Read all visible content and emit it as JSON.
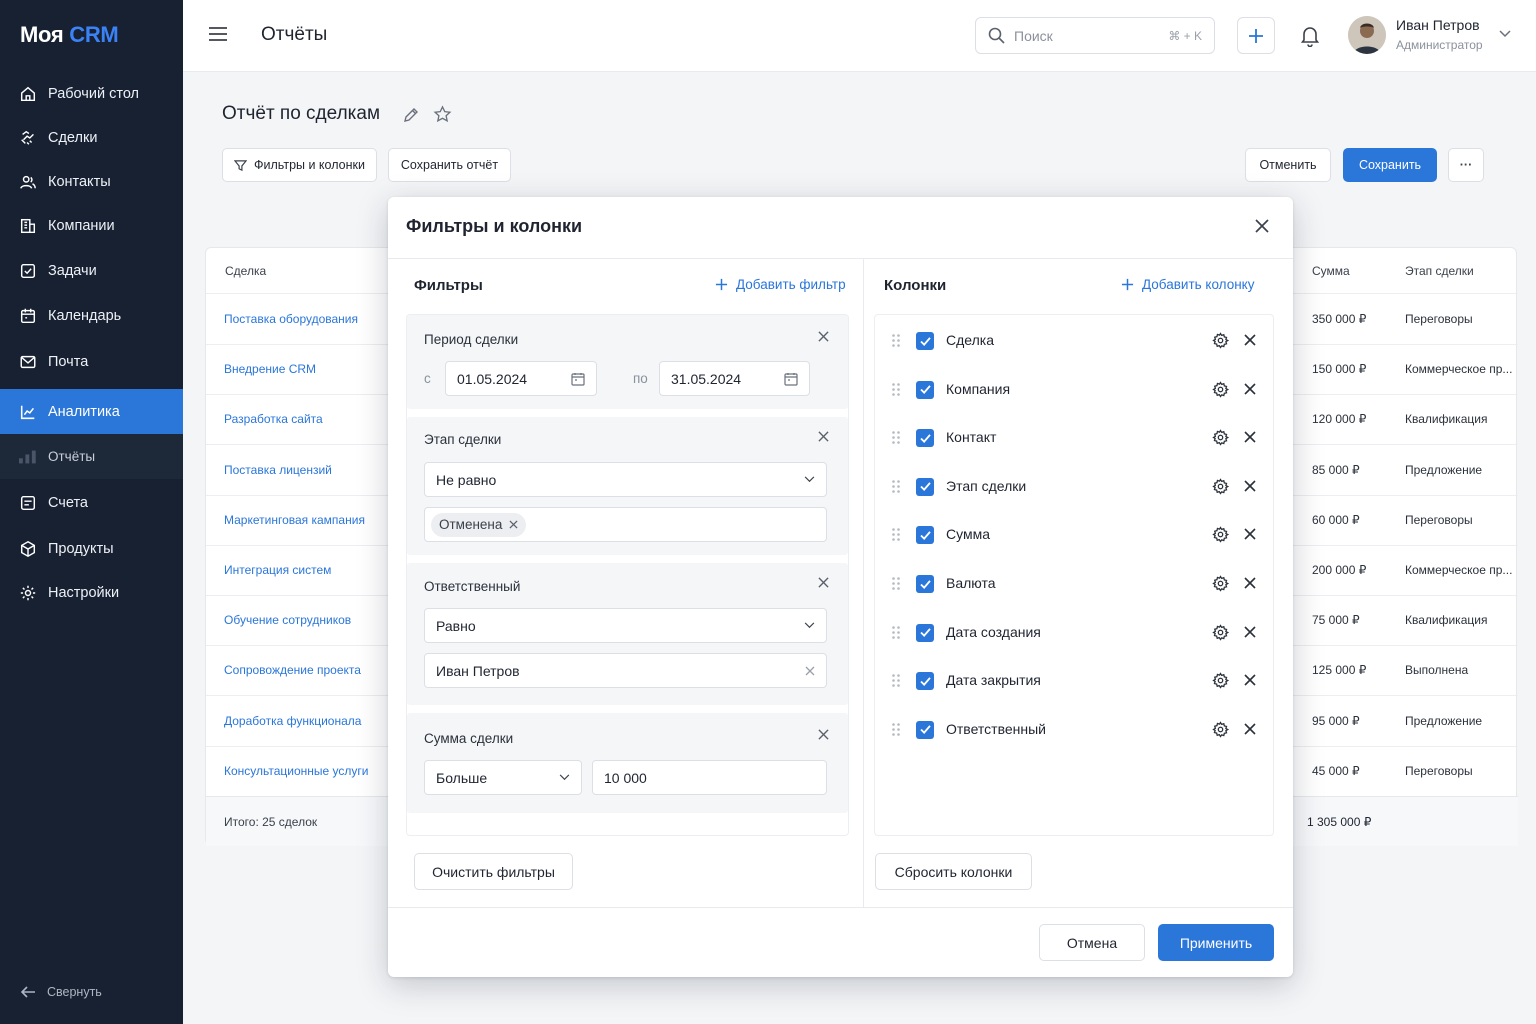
{
  "app": {
    "logo_main": "Моя",
    "logo_accent": "CRM"
  },
  "sidebar": {
    "items": [
      {
        "label": "Рабочий стол",
        "icon": "home-icon"
      },
      {
        "label": "Сделки",
        "icon": "deals-icon"
      },
      {
        "label": "Контакты",
        "icon": "contacts-icon"
      },
      {
        "label": "Компании",
        "icon": "building-icon"
      },
      {
        "label": "Задачи",
        "icon": "tasks-icon"
      },
      {
        "label": "Календарь",
        "icon": "calendar-icon"
      },
      {
        "label": "Почта",
        "icon": "mail-icon"
      },
      {
        "label": "Аналитика",
        "icon": "analytics-icon",
        "active": true
      },
      {
        "label": "Отчёты",
        "icon": "reports-icon",
        "sub": true
      },
      {
        "label": "Счета",
        "icon": "invoice-icon"
      },
      {
        "label": "Продукты",
        "icon": "box-icon"
      },
      {
        "label": "Настройки",
        "icon": "settings-icon"
      }
    ],
    "collapse_label": "Свернуть"
  },
  "header": {
    "title": "Отчёты",
    "search_placeholder": "Поиск",
    "search_shortcut": "⌘ + K",
    "user_name": "Иван Петров",
    "user_role": "Администратор"
  },
  "page": {
    "title": "Отчёт по сделкам",
    "filters_button": "Фильтры и колонки",
    "save_report_button": "Сохранить отчёт",
    "cancel_button": "Отменить",
    "save_button": "Сохранить",
    "more_button": "···"
  },
  "table": {
    "columns": {
      "deal": "Сделка",
      "sum": "Сумма",
      "stage": "Этап сделки"
    },
    "rows": [
      {
        "deal": "Поставка оборудования",
        "sum": "350 000 ₽",
        "stage": "Переговоры"
      },
      {
        "deal": "Внедрение CRM",
        "sum": "150 000 ₽",
        "stage": "Коммерческое пр..."
      },
      {
        "deal": "Разработка сайта",
        "sum": "120 000 ₽",
        "stage": "Квалификация"
      },
      {
        "deal": "Поставка лицензий",
        "sum": "85 000 ₽",
        "stage": "Предложение"
      },
      {
        "deal": "Маркетинговая кампания",
        "sum": "60 000 ₽",
        "stage": "Переговоры"
      },
      {
        "deal": "Интеграция систем",
        "sum": "200 000 ₽",
        "stage": "Коммерческое пр..."
      },
      {
        "deal": "Обучение сотрудников",
        "sum": "75 000 ₽",
        "stage": "Квалификация"
      },
      {
        "deal": "Сопровождение проекта",
        "sum": "125 000 ₽",
        "stage": "Выполнена"
      },
      {
        "deal": "Доработка функционала",
        "sum": "95 000 ₽",
        "stage": "Предложение"
      },
      {
        "deal": "Консультационные услуги",
        "sum": "45 000 ₽",
        "stage": "Переговоры"
      }
    ],
    "footer_total": "Итого: 25 сделок",
    "footer_sum": "1 305 000 ₽"
  },
  "modal": {
    "title": "Фильтры и колонки",
    "filters": {
      "title": "Фильтры",
      "add_label": "Добавить фильтр",
      "period": {
        "title": "Период сделки",
        "from_label": "с",
        "from": "01.05.2024",
        "to_label": "по",
        "to": "31.05.2024"
      },
      "stage": {
        "title": "Этап сделки",
        "operator": "Не равно",
        "chip": "Отменена"
      },
      "owner": {
        "title": "Ответственный",
        "operator": "Равно",
        "value": "Иван Петров"
      },
      "amount": {
        "title": "Сумма сделки",
        "operator": "Больше",
        "value": "10 000"
      },
      "clear_button": "Очистить фильтры"
    },
    "columns": {
      "title": "Колонки",
      "add_label": "Добавить колонку",
      "items": [
        {
          "label": "Сделка",
          "checked": true
        },
        {
          "label": "Компания",
          "checked": true
        },
        {
          "label": "Контакт",
          "checked": true
        },
        {
          "label": "Этап сделки",
          "checked": true
        },
        {
          "label": "Сумма",
          "checked": true
        },
        {
          "label": "Валюта",
          "checked": true
        },
        {
          "label": "Дата создания",
          "checked": true
        },
        {
          "label": "Дата закрытия",
          "checked": true
        },
        {
          "label": "Ответственный",
          "checked": true
        }
      ],
      "reset_button": "Сбросить колонки"
    },
    "cancel_button": "Отмена",
    "apply_button": "Применить"
  },
  "colors": {
    "accent": "#2a76d9",
    "sidebar_bg": "#172132"
  }
}
